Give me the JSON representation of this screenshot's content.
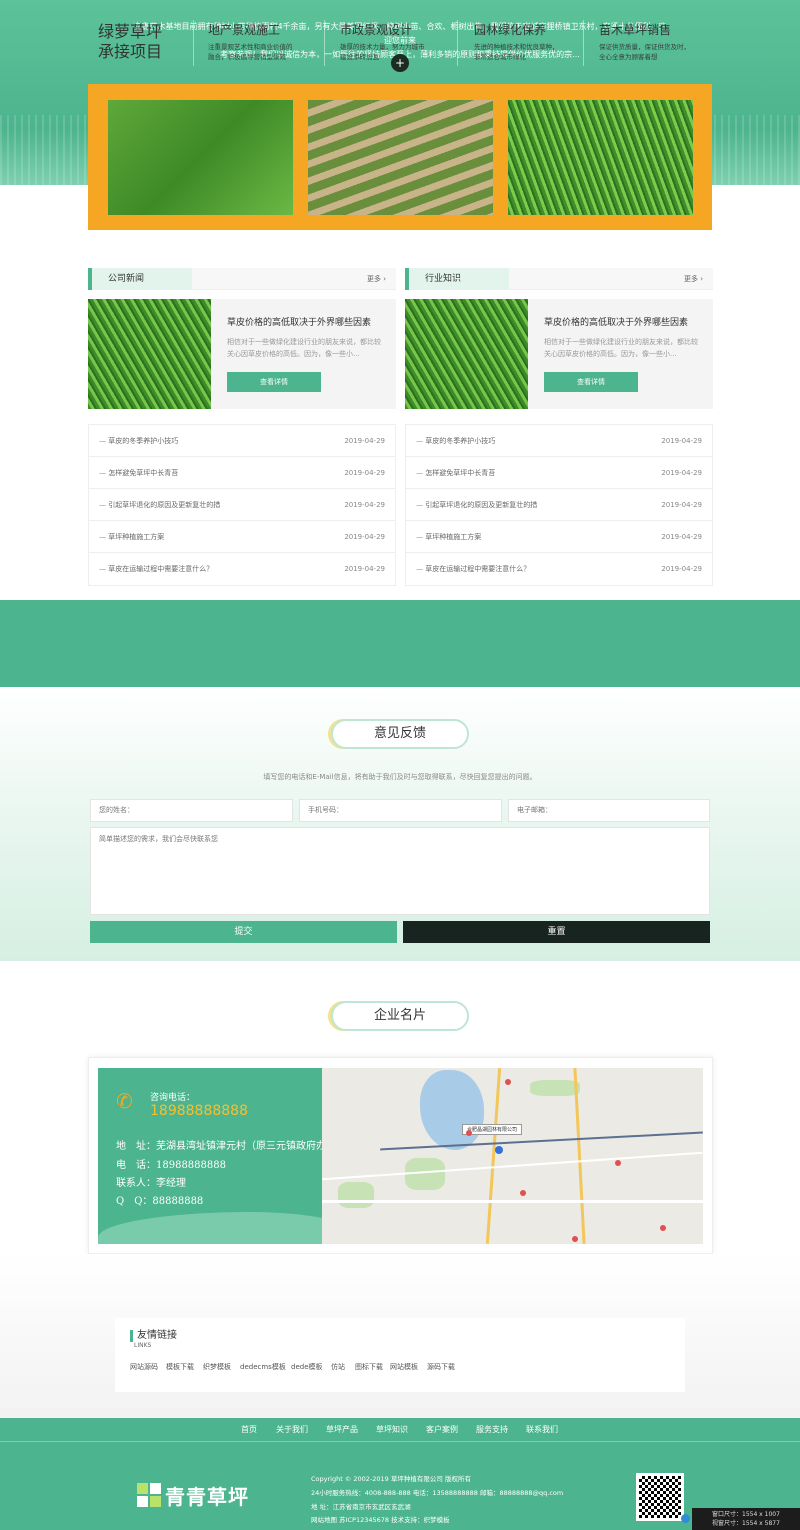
{
  "hero": {
    "intro_line1": "安鑫苗木基地目前拥有种树小苗种植面积4千余亩，另有大量美国红枫、樟树小苗、合欢、栀树出售，我们位于宣城市狸桥镇卫东村，交通十分便利，欢迎您前来",
    "intro_line2": "考察参观！我们以诚信为本，一如既往的坚持顾客至上，薄利多销的原则和秉持提供价优服务优的宗...",
    "more_symbol": "+"
  },
  "news": {
    "left": {
      "tab": "公司新闻",
      "more": "更多 ›",
      "featured_title": "草皮价格的高低取决于外界哪些因素",
      "featured_desc": "相信对于一些做绿化建设行业的朋友来说，都比较关心因草皮价格的高低。因为，像一些小...",
      "featured_button": "查看详情",
      "items": [
        {
          "title": "草皮的冬季养护小技巧",
          "date": "2019-04-29"
        },
        {
          "title": "怎样避免草坪中长青苔",
          "date": "2019-04-29"
        },
        {
          "title": "引起草坪退化的原因及更新复壮的措",
          "date": "2019-04-29"
        },
        {
          "title": "草坪种植施工方案",
          "date": "2019-04-29"
        },
        {
          "title": "草皮在运输过程中需要注意什么？",
          "date": "2019-04-29"
        }
      ]
    },
    "right": {
      "tab": "行业知识",
      "more": "更多 ›",
      "featured_title": "草皮价格的高低取决于外界哪些因素",
      "featured_desc": "相信对于一些做绿化建设行业的朋友来说，都比较关心因草皮价格的高低。因为，像一些小...",
      "featured_button": "查看详情",
      "items": [
        {
          "title": "草皮的冬季养护小技巧",
          "date": "2019-04-29"
        },
        {
          "title": "怎样避免草坪中长青苔",
          "date": "2019-04-29"
        },
        {
          "title": "引起草坪退化的原因及更新复壮的措",
          "date": "2019-04-29"
        },
        {
          "title": "草坪种植施工方案",
          "date": "2019-04-29"
        },
        {
          "title": "草皮在运输过程中需要注意什么？",
          "date": "2019-04-29"
        }
      ]
    }
  },
  "band": {
    "title_line1": "绿萝草坪",
    "title_line2": "承接项目",
    "services": [
      {
        "title": "地产景观施工",
        "desc1": "注重景观艺术性和商业价值的",
        "desc2": "融合，积极倡导营销型景观"
      },
      {
        "title": "市政景观设计",
        "desc1": "雄厚的技术力量，努力为城市",
        "desc2": "建设添砖加瓦"
      },
      {
        "title": "园林绿化保养",
        "desc1": "先进的种植技术和优良草种，",
        "desc2": "非常适合城市绿化"
      },
      {
        "title": "苗木草坪销售",
        "desc1": "保证供货质量，保证供货及时，",
        "desc2": "全心全意为顾客着想"
      }
    ]
  },
  "feedback": {
    "title": "意见反馈",
    "subtitle": "填写您的电话和E-Mail信息，将有助于我们及时与您取得联系，尽快回复您提出的问题。",
    "name_placeholder": "您的姓名：",
    "phone_placeholder": "手机号码：",
    "email_placeholder": "电子邮箱：",
    "message_placeholder": "简单描述您的需求，我们会尽快联系您",
    "submit": "提交",
    "reset": "重置"
  },
  "company": {
    "title": "企业名片",
    "call_label": "咨询电话：",
    "call_number": "18988888888",
    "address": "地　址：芜湖县湾址镇津元村（原三元镇政府办公楼内）",
    "phone": "电　话：18988888888",
    "contact": "联系人：李经理",
    "qq": "Q　Q：88888888",
    "map_label": "合肥晶湖园林有限公司"
  },
  "links": {
    "title": "友情链接",
    "subtitle": "LINKS",
    "items": [
      "网站源码",
      "模板下载",
      "织梦模板",
      "dedecms模板",
      "dede模板",
      "仿站",
      "图标下载",
      "网站模板",
      "源码下载"
    ]
  },
  "footer": {
    "nav": [
      "首页",
      "关于我们",
      "草坪产品",
      "草坪知识",
      "客户案例",
      "服务支持",
      "联系我们"
    ],
    "logo_text": "青青草坪",
    "copyright": "Copyright © 2002-2019 草坪种植有限公司 版权所有",
    "hotline": "24小时服务热线：4008-888-888 电话：13588888888 邮箱：88888888@qq.com",
    "address": "地 址：江苏省南京市玄武区玄武湖",
    "icp": "网站地图 苏ICP12345678 技术支持：织梦模板",
    "dim1": "窗口尺寸：1554 x 1007",
    "dim2": "视窗尺寸：1554 x 5877"
  },
  "colors": {
    "primary": "#4cb48e",
    "accent": "#f5a623",
    "dark": "#18241f"
  }
}
